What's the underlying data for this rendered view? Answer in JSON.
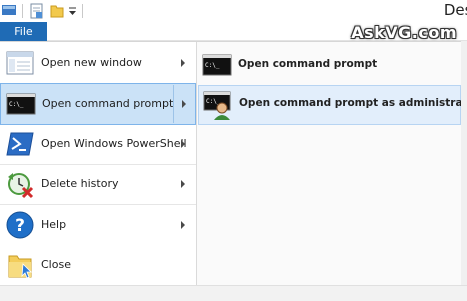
{
  "window": {
    "title": "Deskt"
  },
  "watermark": "AskVG.com",
  "ribbon": {
    "file_tab": "File"
  },
  "file_menu": {
    "items": [
      {
        "label": "Open new window",
        "icon": "open-new-window-icon"
      },
      {
        "label": "Open command prompt",
        "icon": "command-prompt-icon"
      },
      {
        "label": "Open Windows PowerShell",
        "icon": "powershell-icon"
      },
      {
        "label": "Delete history",
        "icon": "delete-history-icon"
      },
      {
        "label": "Help",
        "icon": "help-icon"
      },
      {
        "label": "Close",
        "icon": "close-folder-icon"
      }
    ]
  },
  "submenu": {
    "items": [
      {
        "label": "Open command prompt",
        "icon": "command-prompt-icon"
      },
      {
        "label": "Open command prompt as administrator",
        "icon": "admin-command-prompt-icon"
      }
    ]
  },
  "cmd_icon_text": "C:\\_",
  "colors": {
    "accent": "#1f6bb5",
    "selected_bg": "#cbe2f7",
    "selected_border": "#7eb4ea",
    "hover_bg": "#e2eefb"
  }
}
